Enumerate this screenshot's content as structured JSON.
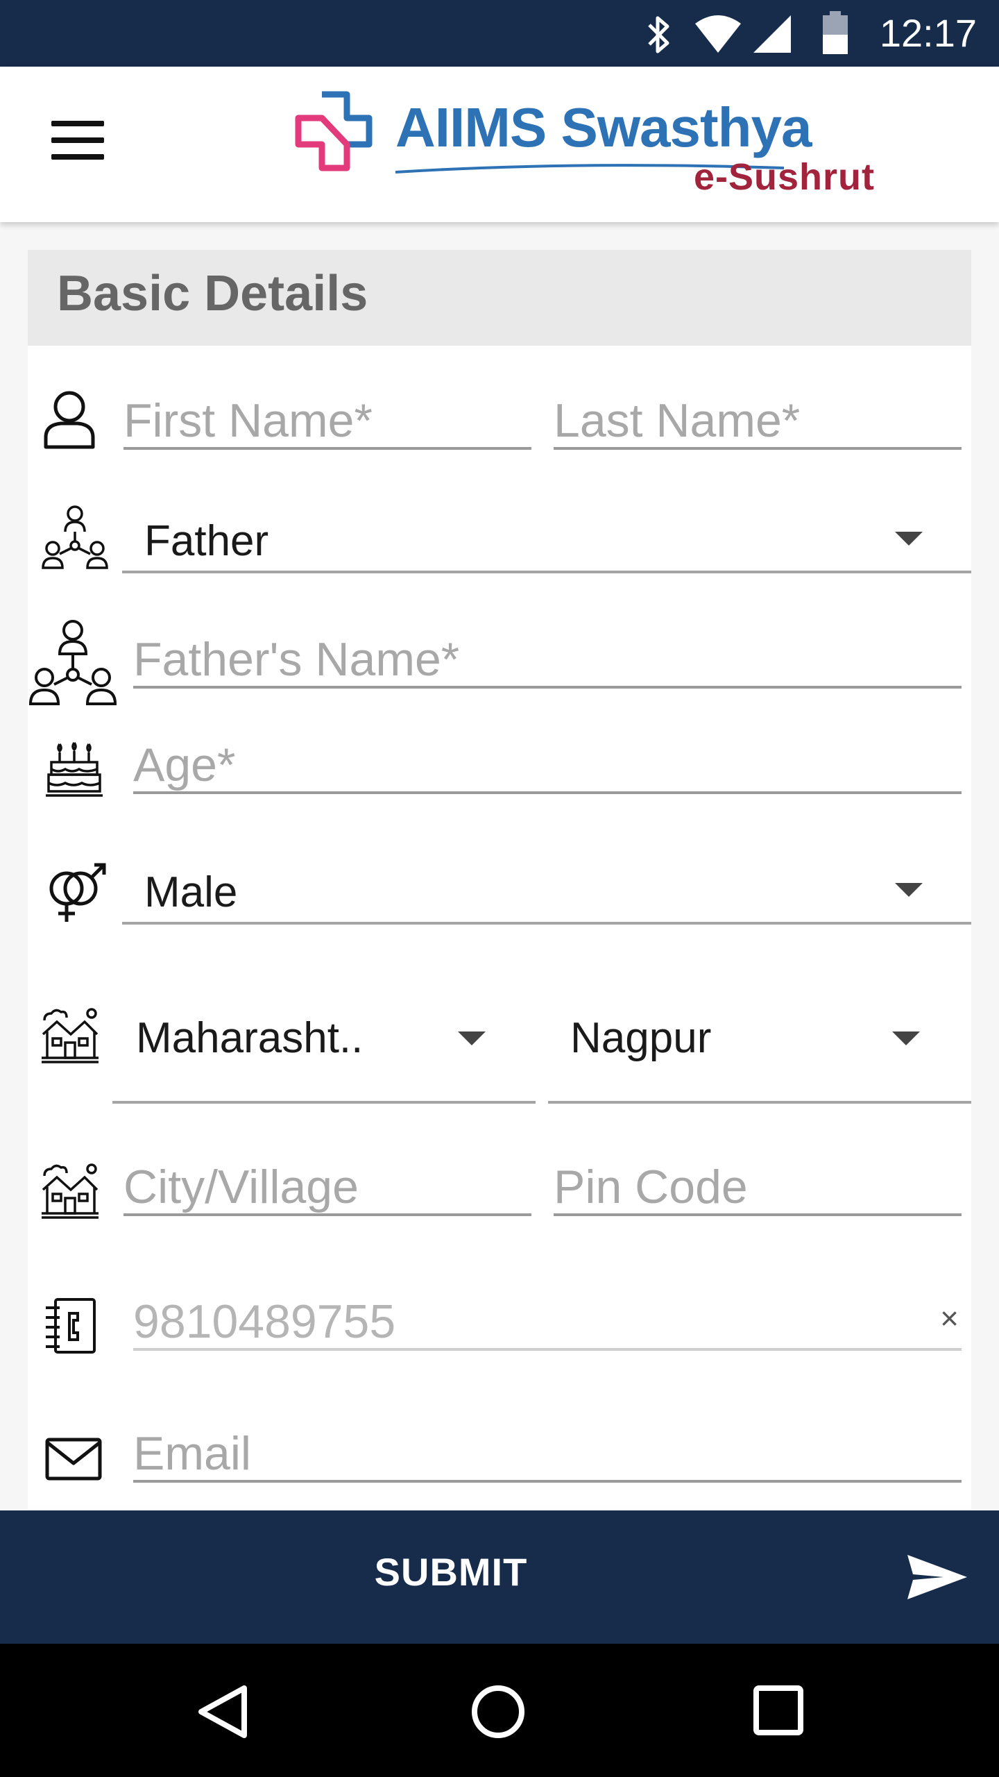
{
  "status_bar": {
    "time": "12:17",
    "icons": [
      "bluetooth-icon",
      "wifi-icon",
      "signal-icon",
      "battery-icon"
    ]
  },
  "app_bar": {
    "menu_icon": "hamburger-menu-icon",
    "logo_brand": "AIIMS Swasthya",
    "logo_sub": "e-Sushrut"
  },
  "form": {
    "section_title": "Basic Details",
    "first_name": {
      "placeholder": "First Name*",
      "value": ""
    },
    "last_name": {
      "placeholder": "Last Name*",
      "value": ""
    },
    "relation": {
      "selected": "Father"
    },
    "relative_name": {
      "placeholder": "Father's Name*",
      "value": ""
    },
    "age": {
      "placeholder": "Age*",
      "value": ""
    },
    "gender": {
      "selected": "Male"
    },
    "state": {
      "selected": "Maharasht.."
    },
    "district": {
      "selected": "Nagpur"
    },
    "city": {
      "placeholder": "City/Village",
      "value": ""
    },
    "pin_code": {
      "placeholder": "Pin Code",
      "value": ""
    },
    "mobile": {
      "value": "9810489755",
      "clear_label": "×"
    },
    "email": {
      "placeholder": "Email",
      "value": ""
    }
  },
  "submit": {
    "label": "SUBMIT"
  },
  "colors": {
    "primary_dark": "#172b4a",
    "logo_blue": "#2e72b6",
    "logo_red": "#a2233c",
    "logo_pink": "#e23a7a"
  }
}
